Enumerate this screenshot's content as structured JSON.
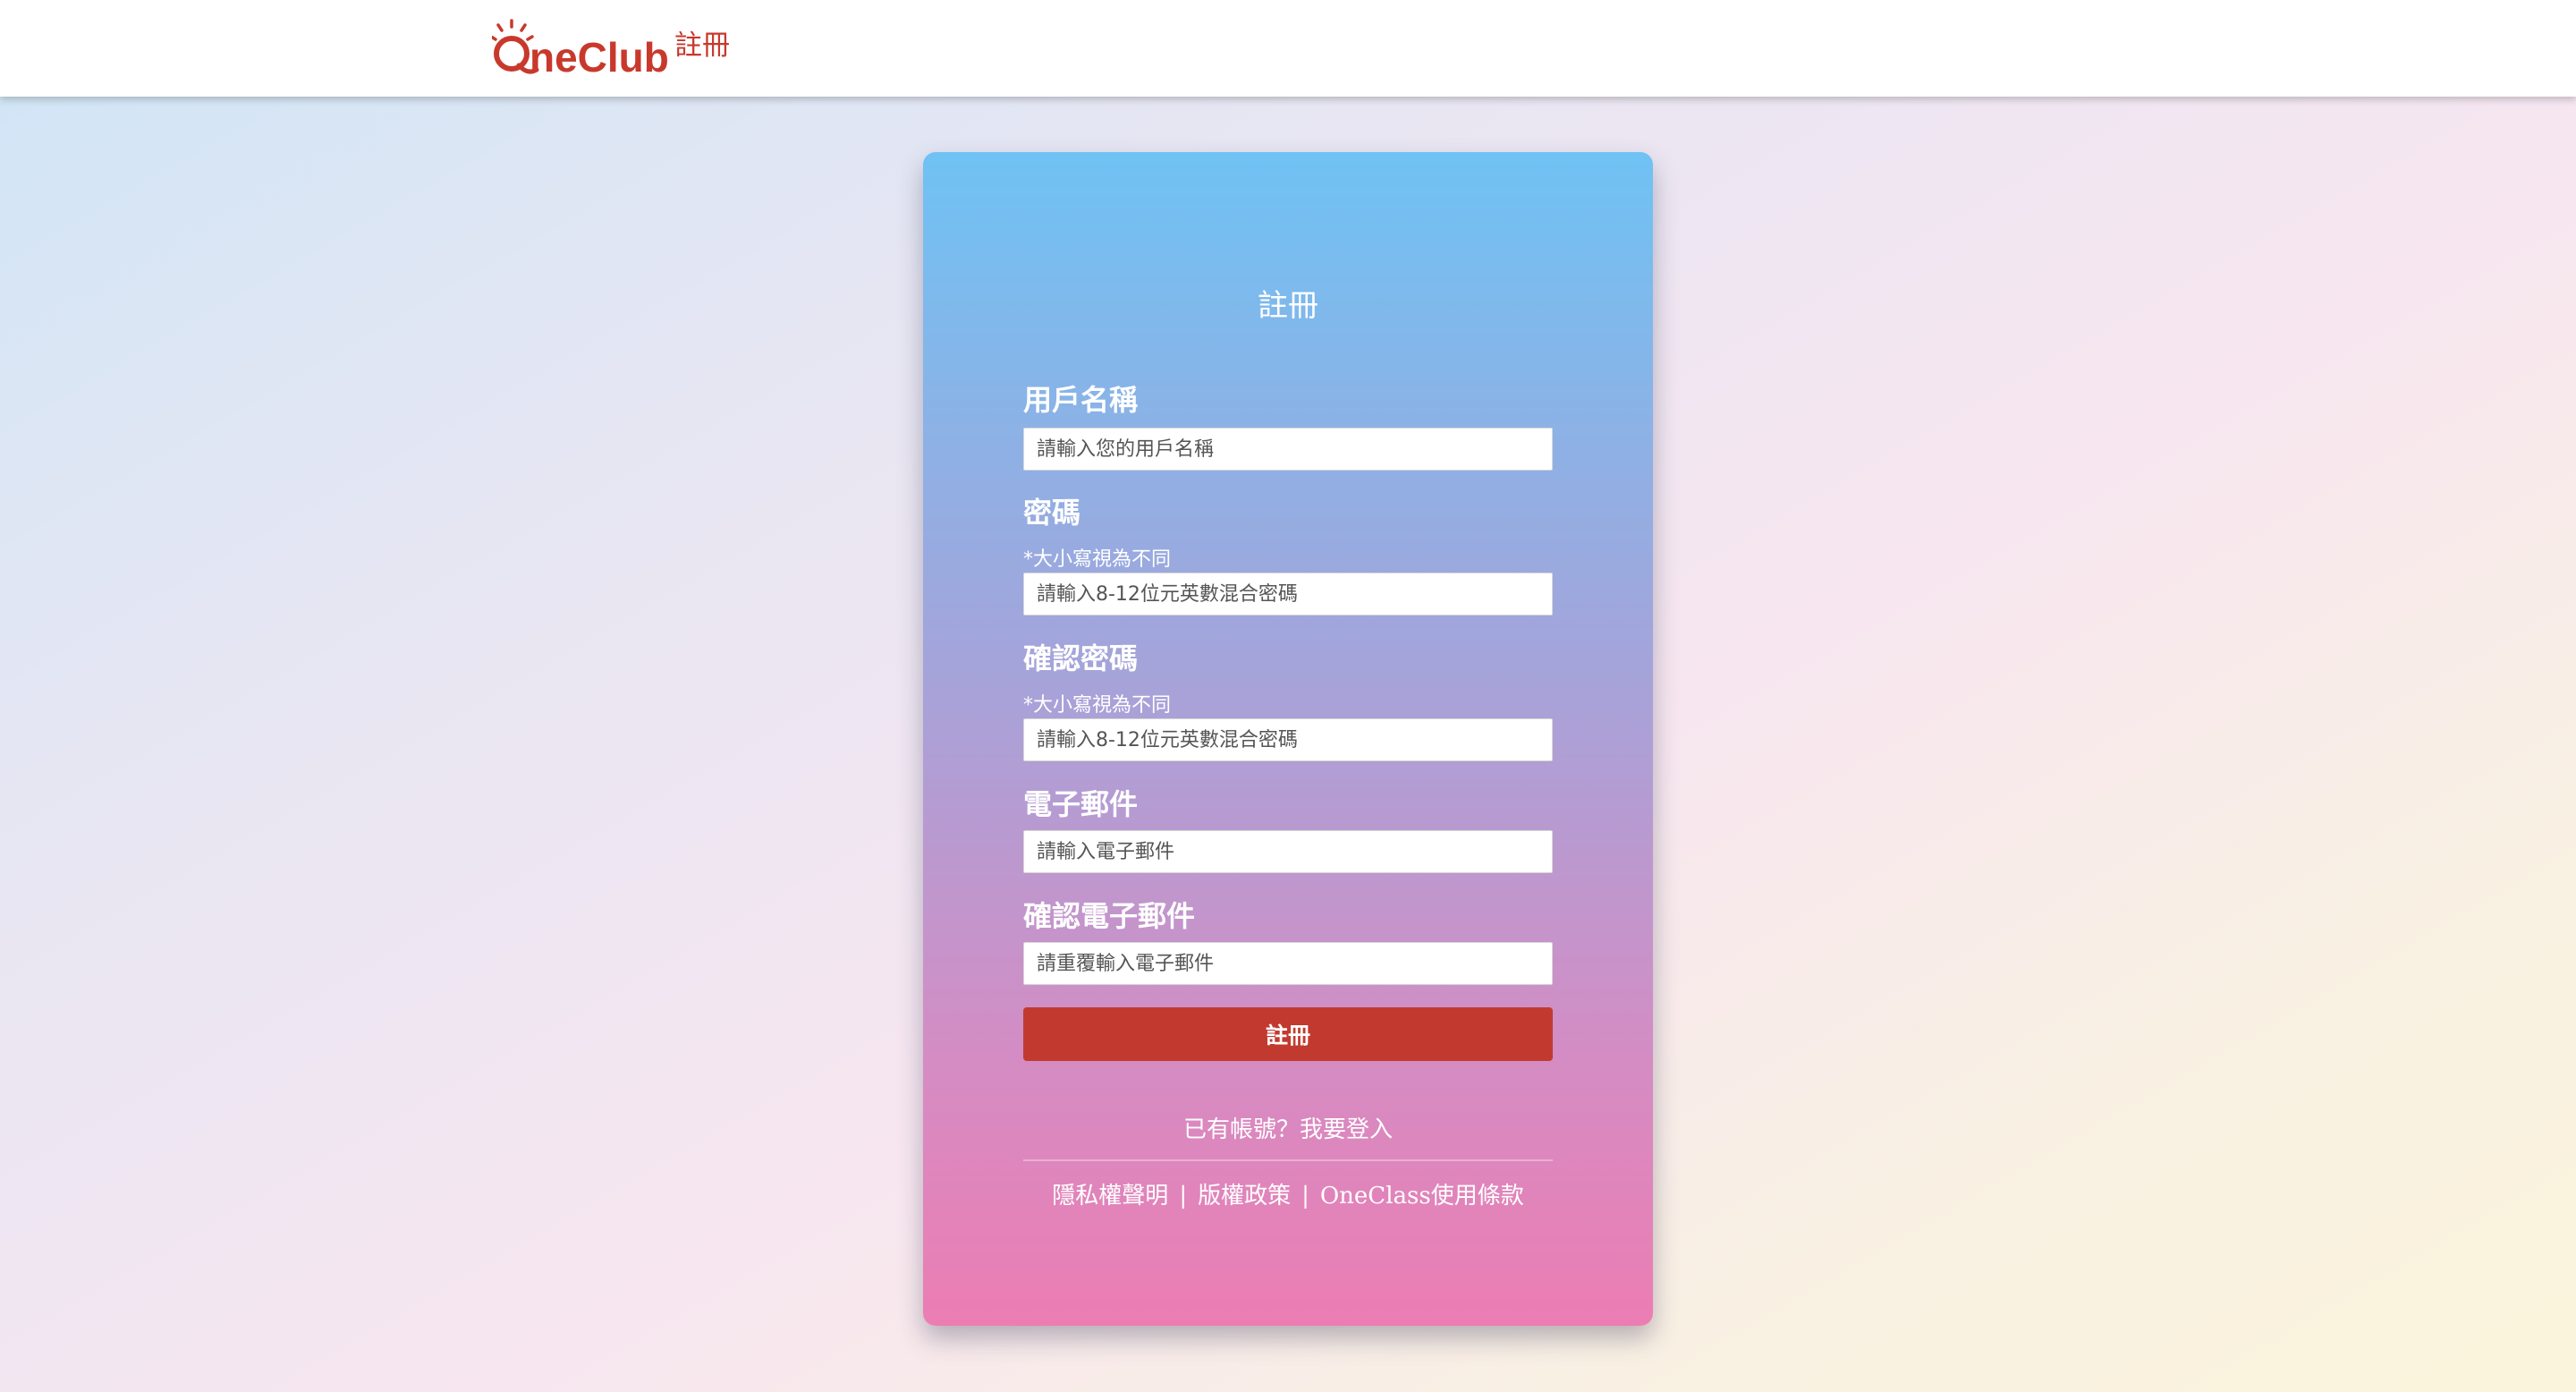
{
  "header": {
    "logo_text": "OneClub",
    "logo_suffix": "註冊"
  },
  "colors": {
    "brand_red": "#c8392c",
    "button_red": "#c23a2f",
    "card_gradient_top": "#6fc2f4",
    "card_gradient_bottom": "#ec7db3"
  },
  "form": {
    "title": "註冊",
    "username": {
      "label": "用戶名稱",
      "placeholder": "請輸入您的用戶名稱",
      "value": ""
    },
    "password": {
      "label": "密碼",
      "hint": "*大小寫視為不同",
      "placeholder": "請輸入8-12位元英數混合密碼",
      "value": ""
    },
    "confirm_password": {
      "label": "確認密碼",
      "hint": "*大小寫視為不同",
      "placeholder": "請輸入8-12位元英數混合密碼",
      "value": ""
    },
    "email": {
      "label": "電子郵件",
      "placeholder": "請輸入電子郵件",
      "value": ""
    },
    "confirm_email": {
      "label": "確認電子郵件",
      "placeholder": "請重覆輸入電子郵件",
      "value": ""
    },
    "submit_label": "註冊",
    "login_link": "已有帳號？我要登入"
  },
  "footer": {
    "privacy": "隱私權聲明",
    "copyright": "版權政策",
    "terms": "OneClass使用條款",
    "separator": "|"
  }
}
